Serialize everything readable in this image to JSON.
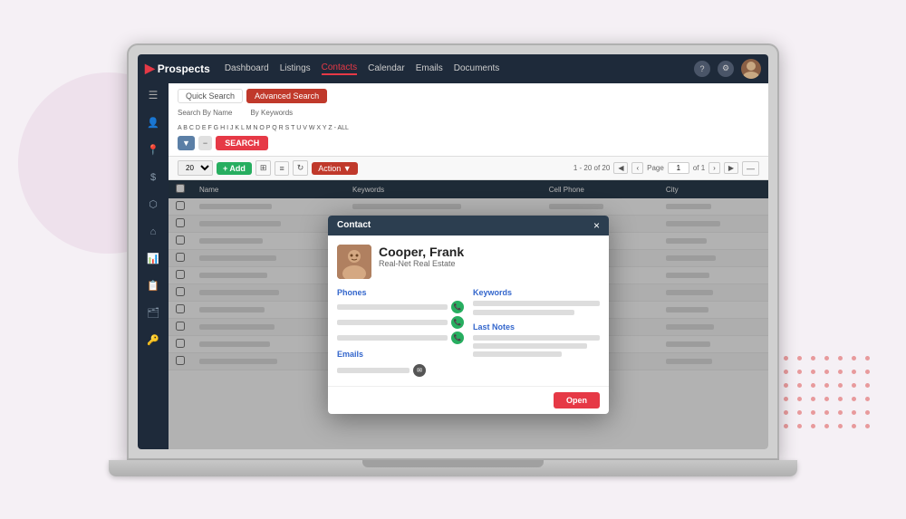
{
  "app": {
    "logo_icon": "▶",
    "logo_text": "Prospects",
    "nav_items": [
      {
        "label": "Dashboard",
        "active": false
      },
      {
        "label": "Listings",
        "active": false
      },
      {
        "label": "Contacts",
        "active": true
      },
      {
        "label": "Calendar",
        "active": false
      },
      {
        "label": "Emails",
        "active": false
      },
      {
        "label": "Documents",
        "active": false
      }
    ],
    "nav_help_icon": "?",
    "nav_settings_icon": "⚙"
  },
  "sidebar": {
    "items": [
      {
        "icon": "☰",
        "name": "menu"
      },
      {
        "icon": "👤",
        "name": "contacts"
      },
      {
        "icon": "📍",
        "name": "locations"
      },
      {
        "icon": "💰",
        "name": "financials"
      },
      {
        "icon": "⬡",
        "name": "properties"
      },
      {
        "icon": "🏠",
        "name": "home"
      },
      {
        "icon": "📊",
        "name": "analytics"
      },
      {
        "icon": "📋",
        "name": "reports"
      },
      {
        "icon": "🗂",
        "name": "files"
      },
      {
        "icon": "🔑",
        "name": "keys"
      }
    ]
  },
  "search": {
    "quick_search_label": "Quick Search",
    "advanced_search_label": "Advanced Search",
    "search_by_name_label": "Search By Name",
    "by_keywords_label": "By Keywords",
    "alphabet": "A B C D E F G H I J K L M N O P Q R S T U V W X Y Z - ALL",
    "search_button": "SEARCH"
  },
  "toolbar": {
    "add_button": "+ Add",
    "action_button": "Action ▼",
    "pagination_info": "1 - 20 of 20",
    "page_label": "Page",
    "of_label": "of 1",
    "page_value": "1"
  },
  "table": {
    "columns": [
      "",
      "Name",
      "Keywords",
      "Cell Phone",
      "City"
    ],
    "rows": [
      {
        "name_width": 80,
        "keywords_width": 120,
        "phone_width": 60,
        "city_width": 50
      },
      {
        "name_width": 90,
        "keywords_width": 100,
        "phone_width": 50,
        "city_width": 60
      },
      {
        "name_width": 70,
        "keywords_width": 110,
        "phone_width": 55,
        "city_width": 45
      },
      {
        "name_width": 85,
        "keywords_width": 90,
        "phone_width": 65,
        "city_width": 55
      },
      {
        "name_width": 75,
        "keywords_width": 115,
        "phone_width": 58,
        "city_width": 48
      },
      {
        "name_width": 88,
        "keywords_width": 95,
        "phone_width": 62,
        "city_width": 52
      },
      {
        "name_width": 72,
        "keywords_width": 105,
        "phone_width": 54,
        "city_width": 47
      },
      {
        "name_width": 83,
        "keywords_width": 98,
        "phone_width": 60,
        "city_width": 53
      },
      {
        "name_width": 78,
        "keywords_width": 112,
        "phone_width": 56,
        "city_width": 49
      },
      {
        "name_width": 86,
        "keywords_width": 88,
        "phone_width": 63,
        "city_width": 51
      }
    ]
  },
  "modal": {
    "title": "Contact",
    "close_button": "×",
    "contact_name": "Cooper, Frank",
    "contact_title": "Real-Net Real Estate",
    "phones_label": "Phones",
    "keywords_label": "Keywords",
    "last_notes_label": "Last Notes",
    "emails_label": "Emails",
    "open_button": "Open",
    "phone_icon": "📞",
    "email_icon": "✉"
  }
}
